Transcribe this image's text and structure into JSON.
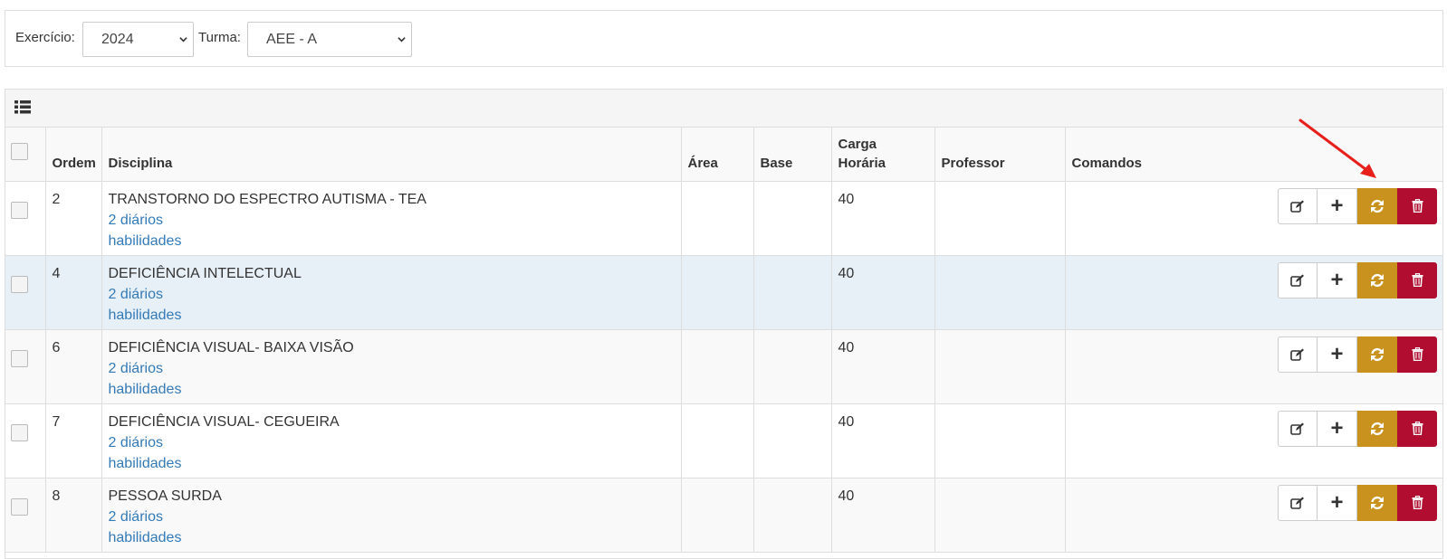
{
  "filters": {
    "exercicio_label": "Exercício:",
    "exercicio_value": "2024",
    "turma_label": "Turma:",
    "turma_value": "AEE - A"
  },
  "table": {
    "headers": {
      "ordem": "Ordem",
      "disciplina": "Disciplina",
      "area": "Área",
      "base": "Base",
      "carga_line1": "Carga",
      "carga_line2": "Horária",
      "professor": "Professor",
      "comandos": "Comandos"
    },
    "rows": [
      {
        "ordem": "2",
        "disciplina": "TRANSTORNO DO ESPECTRO AUTISMA - TEA",
        "diarios": "2 diários",
        "habilidades": "habilidades",
        "area": "",
        "base": "",
        "carga": "40",
        "professor": ""
      },
      {
        "ordem": "4",
        "disciplina": "DEFICIÊNCIA INTELECTUAL",
        "diarios": "2 diários",
        "habilidades": "habilidades",
        "area": "",
        "base": "",
        "carga": "40",
        "professor": ""
      },
      {
        "ordem": "6",
        "disciplina": "DEFICIÊNCIA VISUAL- BAIXA VISÃO",
        "diarios": "2 diários",
        "habilidades": "habilidades",
        "area": "",
        "base": "",
        "carga": "40",
        "professor": ""
      },
      {
        "ordem": "7",
        "disciplina": "DEFICIÊNCIA VISUAL- CEGUEIRA",
        "diarios": "2 diários",
        "habilidades": "habilidades",
        "area": "",
        "base": "",
        "carga": "40",
        "professor": ""
      },
      {
        "ordem": "8",
        "disciplina": "PESSOA SURDA",
        "diarios": "2 diários",
        "habilidades": "habilidades",
        "area": "",
        "base": "",
        "carga": "40",
        "professor": ""
      }
    ]
  },
  "commands": {
    "add_symbol": "+",
    "icons": [
      "edit-icon",
      "plus-icon",
      "refresh-icon",
      "trash-icon"
    ]
  },
  "colors": {
    "link": "#337ab7",
    "sync_button": "#c9921e",
    "delete_button": "#b00d30",
    "annotation_arrow": "#e8201c",
    "hover_row": "#e8f0f7"
  }
}
